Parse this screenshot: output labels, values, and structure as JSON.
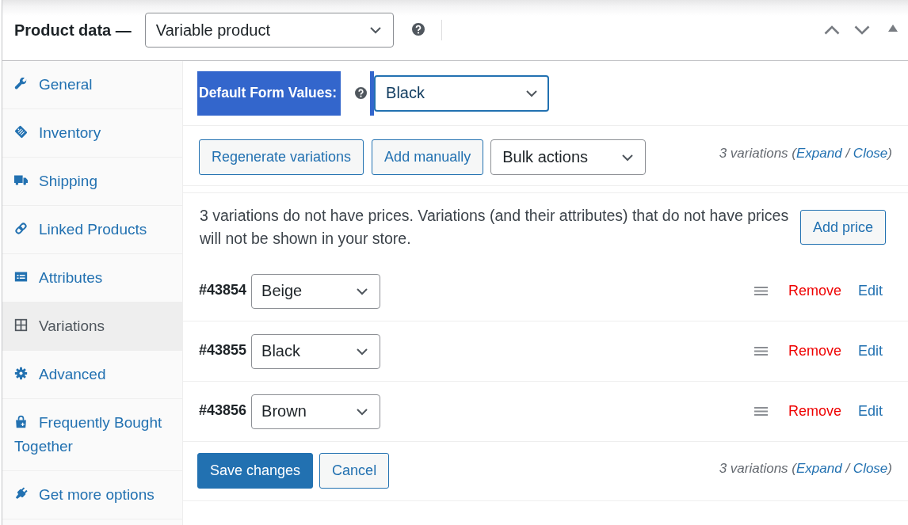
{
  "header": {
    "title": "Product data —",
    "product_type": {
      "value": "Variable product"
    }
  },
  "sidebar": {
    "items": [
      {
        "label": "General",
        "selected": false
      },
      {
        "label": "Inventory",
        "selected": false
      },
      {
        "label": "Shipping",
        "selected": false
      },
      {
        "label": "Linked Products",
        "selected": false
      },
      {
        "label": "Attributes",
        "selected": false
      },
      {
        "label": "Variations",
        "selected": true
      },
      {
        "label": "Advanced",
        "selected": false
      },
      {
        "label": "Frequently Bought Together",
        "selected": false
      },
      {
        "label": "Get more options",
        "selected": false
      }
    ]
  },
  "default_form": {
    "label": "Default Form Values:",
    "highlighted": true,
    "select": {
      "value": "Black",
      "focused": true
    }
  },
  "toolbar": {
    "buttons": [
      "Regenerate variations",
      "Add manually"
    ],
    "bulk_actions": {
      "value": "Bulk actions"
    },
    "summary": [
      {
        "kind": "text",
        "text": "3 variations ("
      },
      {
        "kind": "link",
        "text": "Expand"
      },
      {
        "kind": "text",
        "text": " / "
      },
      {
        "kind": "link",
        "text": "Close"
      },
      {
        "kind": "text",
        "text": ")"
      }
    ]
  },
  "notice": {
    "text": "3 variations do not have prices. Variations (and their attributes) that do not have prices will not be shown in your store.",
    "button": "Add price"
  },
  "variations": [
    {
      "id": "#43854",
      "attribute": {
        "value": "Beige"
      },
      "remove": "Remove",
      "edit": "Edit"
    },
    {
      "id": "#43855",
      "attribute": {
        "value": "Black"
      },
      "remove": "Remove",
      "edit": "Edit"
    },
    {
      "id": "#43856",
      "attribute": {
        "value": "Brown"
      },
      "remove": "Remove",
      "edit": "Edit"
    }
  ],
  "footer": {
    "buttons": [
      {
        "kind": "primary",
        "label": "Save changes"
      },
      {
        "kind": "secondary",
        "label": "Cancel"
      }
    ],
    "summary": [
      {
        "kind": "text",
        "text": "3 variations ("
      },
      {
        "kind": "link",
        "text": "Expand"
      },
      {
        "kind": "text",
        "text": " / "
      },
      {
        "kind": "link",
        "text": "Close"
      },
      {
        "kind": "text",
        "text": ")"
      }
    ]
  }
}
